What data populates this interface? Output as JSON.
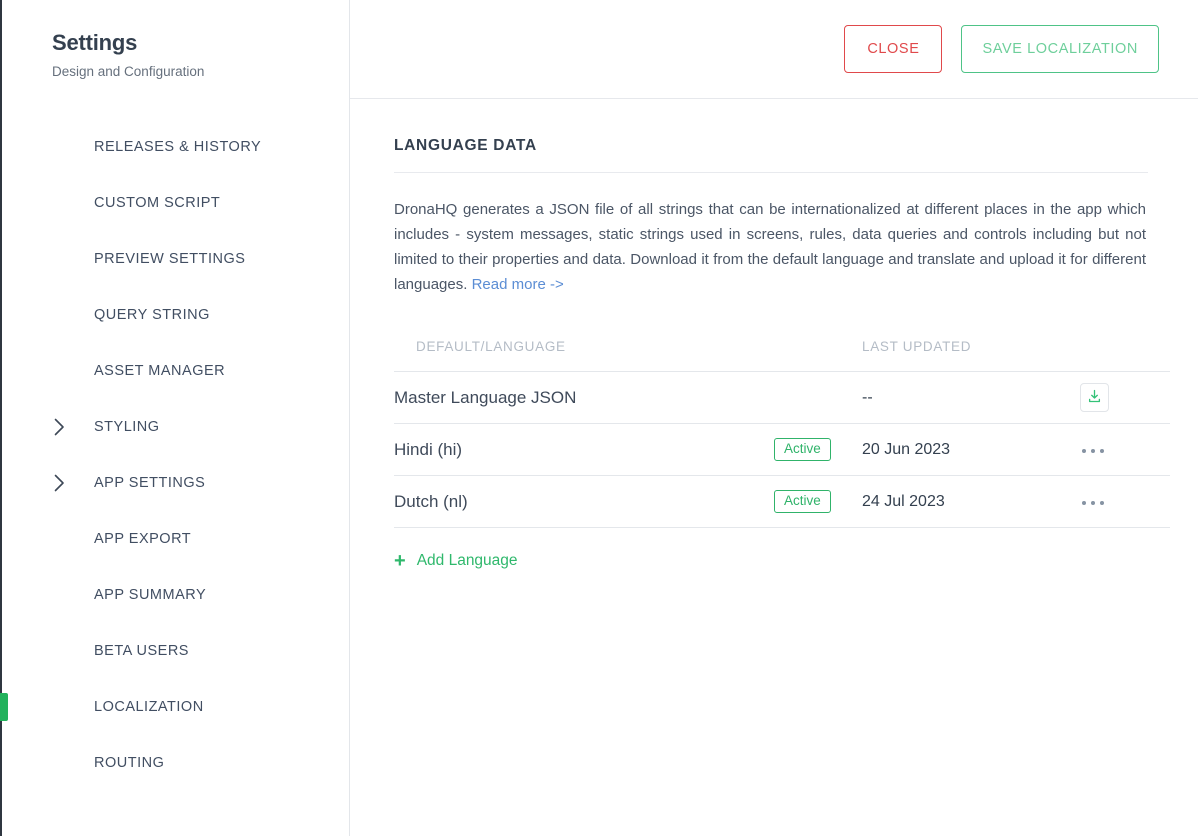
{
  "sidebar": {
    "title": "Settings",
    "subtitle": "Design and Configuration",
    "items": [
      {
        "label": "RELEASES & HISTORY",
        "expandable": false,
        "active": false
      },
      {
        "label": "CUSTOM SCRIPT",
        "expandable": false,
        "active": false
      },
      {
        "label": "PREVIEW SETTINGS",
        "expandable": false,
        "active": false
      },
      {
        "label": "QUERY STRING",
        "expandable": false,
        "active": false
      },
      {
        "label": "ASSET MANAGER",
        "expandable": false,
        "active": false
      },
      {
        "label": "STYLING",
        "expandable": true,
        "active": false
      },
      {
        "label": "APP SETTINGS",
        "expandable": true,
        "active": false
      },
      {
        "label": "APP EXPORT",
        "expandable": false,
        "active": false
      },
      {
        "label": "APP SUMMARY",
        "expandable": false,
        "active": false
      },
      {
        "label": "BETA USERS",
        "expandable": false,
        "active": false
      },
      {
        "label": "LOCALIZATION",
        "expandable": false,
        "active": true
      },
      {
        "label": "ROUTING",
        "expandable": false,
        "active": false
      }
    ]
  },
  "topbar": {
    "close_label": "CLOSE",
    "save_label": "SAVE LOCALIZATION"
  },
  "main": {
    "section_title": "LANGUAGE DATA",
    "description": "DronaHQ generates a JSON file of all strings that can be internationalized at different places in the app which includes - system messages, static strings used in screens, rules, data queries and controls including but not limited to their properties and data. Download it from the default language and translate and upload it for different languages. ",
    "read_more_label": "Read more ->",
    "add_language_label": "Add Language",
    "add_language_plus": "+"
  },
  "table": {
    "headers": {
      "language": "DEFAULT/LANGUAGE",
      "status": "",
      "last_updated": "LAST UPDATED",
      "actions": ""
    },
    "rows": [
      {
        "language": "Master Language JSON",
        "status": "",
        "last_updated": "--",
        "action": "download"
      },
      {
        "language": "Hindi (hi)",
        "status": "Active",
        "last_updated": "20 Jun 2023",
        "action": "menu"
      },
      {
        "language": "Dutch (nl)",
        "status": "Active",
        "last_updated": "24 Jul 2023",
        "action": "menu"
      }
    ]
  },
  "colors": {
    "accent_green": "#2fb86c",
    "active_indicator": "#22b25c",
    "close_red": "#e0494b",
    "save_green": "#6ecf9b",
    "link_blue": "#5b8dd4",
    "text_dark": "#34404f",
    "header_gray": "#b4bcc6"
  }
}
